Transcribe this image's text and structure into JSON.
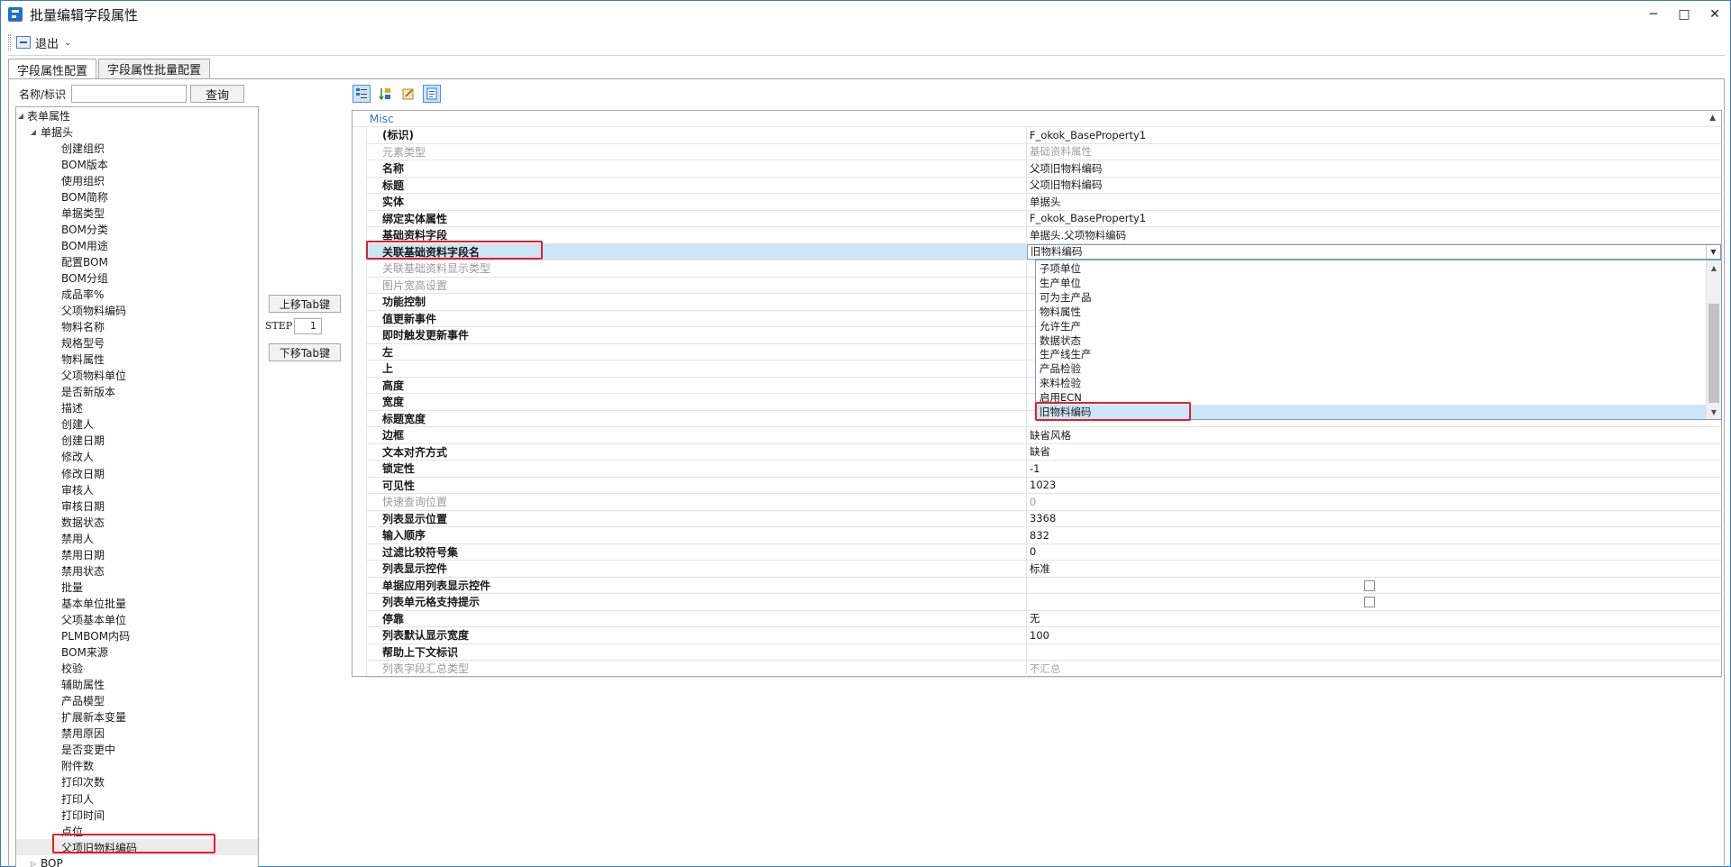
{
  "window": {
    "title": "批量编辑字段属性",
    "controls": {
      "minimize": "─",
      "maximize": "□",
      "close": "✕"
    }
  },
  "toolbar": {
    "exit_label": "退出",
    "exit_caret": "⌄"
  },
  "tabs": [
    {
      "label": "字段属性配置",
      "active": true
    },
    {
      "label": "字段属性批量配置",
      "active": false
    }
  ],
  "search": {
    "label": "名称/标识",
    "value": "",
    "button": "查询"
  },
  "tree": {
    "root": "表单属性",
    "group": "单据头",
    "items": [
      "创建组织",
      "BOM版本",
      "使用组织",
      "BOM简称",
      "单据类型",
      "BOM分类",
      "BOM用途",
      "配置BOM",
      "BOM分组",
      "成品率%",
      "父项物料编码",
      "物料名称",
      "规格型号",
      "物料属性",
      "父项物料单位",
      "是否新版本",
      "描述",
      "创建人",
      "创建日期",
      "修改人",
      "修改日期",
      "审核人",
      "审核日期",
      "数据状态",
      "禁用人",
      "禁用日期",
      "禁用状态",
      "批量",
      "基本单位批量",
      "父项基本单位",
      "PLMBOM内码",
      "BOM来源",
      "校验",
      "辅助属性",
      "产品模型",
      "扩展新本变量",
      "禁用原因",
      "是否变更中",
      "附件数",
      "打印次数",
      "打印人",
      "打印时间",
      "点位",
      "父项旧物料编码"
    ],
    "selected_item": "父项旧物料编码",
    "next_group": "BOP"
  },
  "middle": {
    "move_up": "上移Tab键",
    "step_label": "STEP",
    "step_value": "1",
    "move_down": "下移Tab键"
  },
  "property_grid": {
    "toolbar_icons": [
      "categorized-icon",
      "alphabetical-icon",
      "property-pages-icon",
      "properties-icon"
    ],
    "category": "Misc",
    "rows": [
      {
        "name": "(标识)",
        "value": "F_okok_BaseProperty1",
        "disabled": false
      },
      {
        "name": "元素类型",
        "value": "基础资料属性",
        "disabled": true
      },
      {
        "name": "名称",
        "value": "父项旧物料编码",
        "disabled": false
      },
      {
        "name": "标题",
        "value": "父项旧物料编码",
        "disabled": false
      },
      {
        "name": "实体",
        "value": "单据头",
        "disabled": false
      },
      {
        "name": "绑定实体属性",
        "value": "F_okok_BaseProperty1",
        "disabled": false
      },
      {
        "name": "基础资料字段",
        "value": "单据头.父项物料编码",
        "disabled": false
      },
      {
        "name": "关联基础资料字段名",
        "value": "旧物料编码",
        "disabled": false,
        "selected": true
      },
      {
        "name": "关联基础资料显示类型",
        "value": "",
        "disabled": true
      },
      {
        "name": "图片宽高设置",
        "value": "",
        "disabled": true
      },
      {
        "name": "功能控制",
        "value": "",
        "disabled": false
      },
      {
        "name": "值更新事件",
        "value": "",
        "disabled": false
      },
      {
        "name": "即时触发更新事件",
        "value": "",
        "disabled": false
      },
      {
        "name": "左",
        "value": "",
        "disabled": false
      },
      {
        "name": "上",
        "value": "",
        "disabled": false
      },
      {
        "name": "高度",
        "value": "",
        "disabled": false
      },
      {
        "name": "宽度",
        "value": "",
        "disabled": false
      },
      {
        "name": "标题宽度",
        "value": "",
        "disabled": false
      },
      {
        "name": "边框",
        "value": "缺省风格",
        "disabled": false
      },
      {
        "name": "文本对齐方式",
        "value": "缺省",
        "disabled": false
      },
      {
        "name": "锁定性",
        "value": "-1",
        "disabled": false
      },
      {
        "name": "可见性",
        "value": "1023",
        "disabled": false
      },
      {
        "name": "快速查询位置",
        "value": "0",
        "disabled": true
      },
      {
        "name": "列表显示位置",
        "value": "3368",
        "disabled": false
      },
      {
        "name": "输入顺序",
        "value": "832",
        "disabled": false
      },
      {
        "name": "过滤比较符号集",
        "value": "0",
        "disabled": false
      },
      {
        "name": "列表显示控件",
        "value": "标准",
        "disabled": false
      },
      {
        "name": "单据应用列表显示控件",
        "value": "",
        "disabled": false,
        "checkbox": true
      },
      {
        "name": "列表单元格支持提示",
        "value": "",
        "disabled": false,
        "checkbox": true
      },
      {
        "name": "停靠",
        "value": "无",
        "disabled": false
      },
      {
        "name": "列表默认显示宽度",
        "value": "100",
        "disabled": false
      },
      {
        "name": "帮助上下文标识",
        "value": "",
        "disabled": false
      },
      {
        "name": "列表字段汇总类型",
        "value": "不汇总",
        "disabled": true
      }
    ],
    "dropdown": {
      "options": [
        "子项单位",
        "生产单位",
        "可为主产品",
        "物料属性",
        "允许生产",
        "数据状态",
        "生产线生产",
        "产品检验",
        "来料检验",
        "启用ECN",
        "旧物料编码"
      ],
      "selected": "旧物料编码"
    }
  },
  "colors": {
    "accent": "#3c78c8",
    "selection": "#cde6f7",
    "annotation": "#e0202a",
    "disabled_text": "#9a9a9a"
  }
}
